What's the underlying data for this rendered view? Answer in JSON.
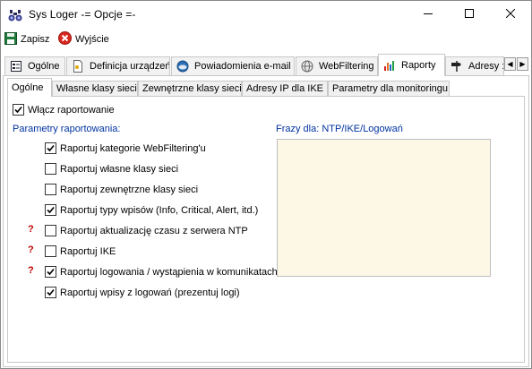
{
  "window": {
    "title": "Sys Loger -= Opcje =-"
  },
  "toolbar": {
    "save_label": "Zapisz",
    "exit_label": "Wyjście"
  },
  "main_tabs": [
    {
      "label": "Ogólne",
      "icon": "form-icon"
    },
    {
      "label": "Definicja urządzeń",
      "icon": "document-icon"
    },
    {
      "label": "Powiadomienia e-mail",
      "icon": "email-icon"
    },
    {
      "label": "WebFiltering",
      "icon": "globe-icon"
    },
    {
      "label": "Raporty",
      "icon": "bar-chart-icon",
      "active": true
    },
    {
      "label": "Adresy :",
      "icon": "signpost-icon"
    }
  ],
  "sub_tabs": [
    {
      "label": "Ogólne",
      "active": true
    },
    {
      "label": "Własne klasy sieci"
    },
    {
      "label": "Zewnętrzne klasy sieci"
    },
    {
      "label": "Adresy IP dla IKE"
    },
    {
      "label": "Parametry dla monitoringu"
    }
  ],
  "enable_reporting": {
    "label": "Włącz raportowanie",
    "checked": true
  },
  "report_params": {
    "title": "Parametry raportowania:",
    "items": [
      {
        "label": "Raportuj kategorie WebFiltering'u",
        "checked": true,
        "warning": ""
      },
      {
        "label": "Raportuj własne klasy sieci",
        "checked": false,
        "warning": ""
      },
      {
        "label": "Raportuj zewnętrzne klasy sieci",
        "checked": false,
        "warning": ""
      },
      {
        "label": "Raportuj typy wpisów (Info, Critical, Alert, itd.)",
        "checked": true,
        "warning": ""
      },
      {
        "label": "Raportuj aktualizację czasu z serwera NTP",
        "checked": false,
        "warning": "?"
      },
      {
        "label": "Raportuj IKE",
        "checked": false,
        "warning": "?"
      },
      {
        "label": "Raportuj logowania / wystąpienia w komunikatach",
        "checked": true,
        "warning": "?"
      },
      {
        "label": "Raportuj wpisy z logowań (prezentuj logi)",
        "checked": true,
        "warning": ""
      }
    ]
  },
  "phrases": {
    "label": "Frazy dla: NTP/IKE/Logowań",
    "value": ""
  },
  "colors": {
    "section_label": "#0033a0",
    "warning": "#c00000",
    "phrases_bg": "#fdf7e6"
  }
}
